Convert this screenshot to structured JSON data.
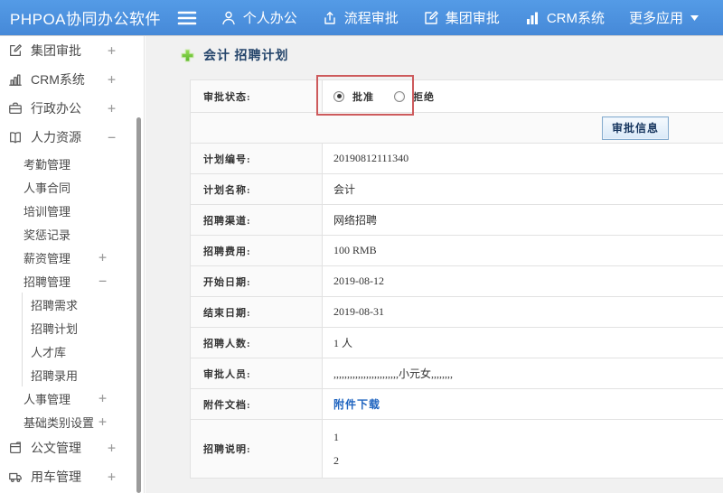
{
  "header": {
    "logo": "PHPOA协同办公软件",
    "nav": [
      {
        "key": "personal",
        "icon": "user",
        "label": "个人办公"
      },
      {
        "key": "process",
        "icon": "flow",
        "label": "流程审批"
      },
      {
        "key": "group",
        "icon": "edit",
        "label": "集团审批"
      },
      {
        "key": "crm",
        "icon": "chart",
        "label": "CRM系统"
      },
      {
        "key": "more",
        "icon": "grid",
        "label": "更多应用",
        "caret": true
      }
    ]
  },
  "sidebar": {
    "items": [
      {
        "label": "集团审批",
        "icon": "edit-square",
        "expander": "+",
        "level": 1
      },
      {
        "label": "CRM系统",
        "icon": "bar-chart",
        "expander": "+",
        "level": 1
      },
      {
        "label": "行政办公",
        "icon": "briefcase",
        "expander": "+",
        "level": 1
      },
      {
        "label": "人力资源",
        "icon": "book",
        "expander": "−",
        "level": 1
      },
      {
        "label": "考勤管理",
        "level": 2
      },
      {
        "label": "人事合同",
        "level": 2
      },
      {
        "label": "培训管理",
        "level": 2
      },
      {
        "label": "奖惩记录",
        "level": 2
      },
      {
        "label": "薪资管理",
        "expander": "+",
        "level": 2
      },
      {
        "label": "招聘管理",
        "expander": "−",
        "level": 2
      },
      {
        "label": "招聘需求",
        "level": 3
      },
      {
        "label": "招聘计划",
        "level": 3
      },
      {
        "label": "人才库",
        "level": 3
      },
      {
        "label": "招聘录用",
        "level": 3
      },
      {
        "label": "人事管理",
        "expander": "+",
        "level": 2
      },
      {
        "label": "基础类别设置",
        "expander": "+",
        "level": 2
      },
      {
        "label": "公文管理",
        "icon": "doc",
        "expander": "+",
        "level": 1
      },
      {
        "label": "用车管理",
        "icon": "truck",
        "expander": "+",
        "level": 1
      }
    ]
  },
  "main": {
    "title": "会计 招聘计划",
    "form": {
      "status": {
        "label": "审批状态:",
        "options": [
          {
            "key": "approve",
            "label": "批准",
            "selected": true
          },
          {
            "key": "reject",
            "label": "拒绝",
            "selected": false
          }
        ]
      },
      "info_button": "审批信息",
      "fields": [
        {
          "label": "计划编号:",
          "value": "20190812111340"
        },
        {
          "label": "计划名称:",
          "value": "会计"
        },
        {
          "label": "招聘渠道:",
          "value": "网络招聘"
        },
        {
          "label": "招聘费用:",
          "value": "100 RMB"
        },
        {
          "label": "开始日期:",
          "value": "2019-08-12"
        },
        {
          "label": "结束日期:",
          "value": "2019-08-31"
        },
        {
          "label": "招聘人数:",
          "value": "1 人"
        },
        {
          "label": "审批人员:",
          "value": ",,,,,,,,,,,,,,,,,,,,,,,,小元女,,,,,,,,"
        },
        {
          "label": "附件文档:",
          "value": "附件下载",
          "type": "link"
        },
        {
          "label": "招聘说明:",
          "lines": [
            "1",
            "2"
          ],
          "type": "multiline"
        }
      ]
    }
  },
  "colors": {
    "header_blue": "#4a90dd",
    "highlight_red": "#cd5a5c",
    "link_blue": "#2065c0",
    "title_navy": "#25456b",
    "accent_green": "#6cc234"
  }
}
